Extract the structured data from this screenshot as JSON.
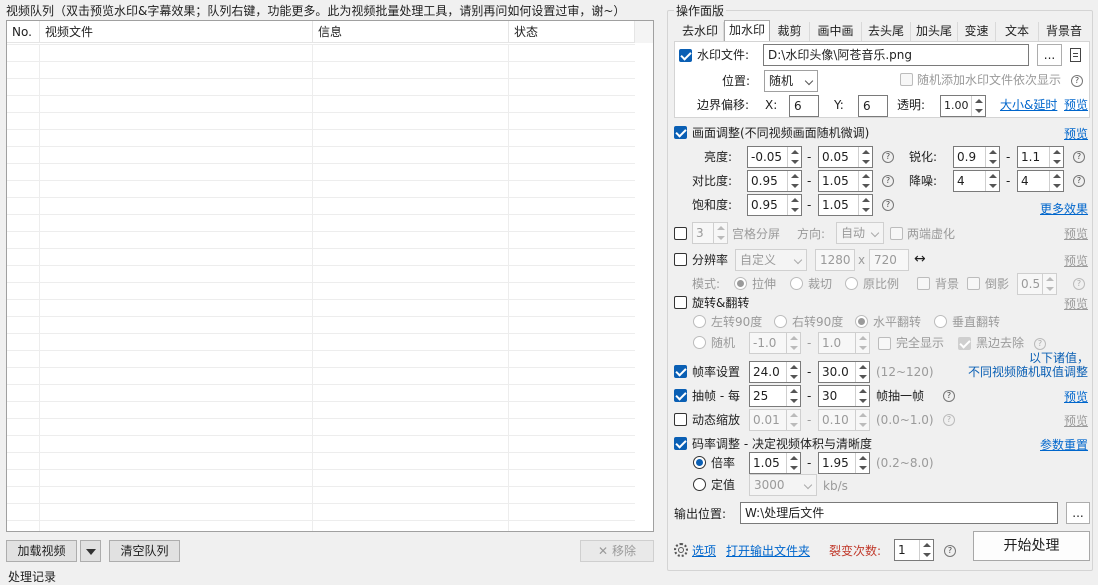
{
  "queue": {
    "title": "视频队列（双击预览水印&字幕效果；队列右键，功能更多。此为视频批量处理工具，请别再问如何设置过审，谢~）",
    "columns": [
      "No.",
      "视频文件",
      "信息",
      "状态"
    ],
    "load_video": "加载视频",
    "clear_queue": "清空队列",
    "remove": "移除",
    "log_title": "处理记录"
  },
  "panel": {
    "title": "操作面版",
    "tabs": [
      "去水印",
      "加水印",
      "裁剪",
      "画中画",
      "去头尾",
      "加头尾",
      "变速",
      "文本",
      "背景音"
    ],
    "active_tab": 1,
    "watermark": {
      "file_label": "水印文件:",
      "file_value": "D:\\水印头像\\阿苍音乐.png",
      "browse": "...",
      "position_label": "位置:",
      "position_value": "随机",
      "random_add_label": "随机添加水印文件依次显示",
      "margin_label": "边界偏移:",
      "x_label": "X:",
      "x_value": "6",
      "y_label": "Y:",
      "y_value": "6",
      "opacity_label": "透明:",
      "opacity_value": "1.00",
      "size_delay_link": "大小&延时",
      "preview": "预览"
    },
    "picture": {
      "label": "画面调整(不同视频画面随机微调)",
      "preview": "预览",
      "brightness_label": "亮度:",
      "brightness_min": "-0.05",
      "brightness_max": "0.05",
      "contrast_label": "对比度:",
      "contrast_min": "0.95",
      "contrast_max": "1.05",
      "saturation_label": "饱和度:",
      "saturation_min": "0.95",
      "saturation_max": "1.05",
      "sharpen_label": "锐化:",
      "sharpen_min": "0.9",
      "sharpen_max": "1.1",
      "denoise_label": "降噪:",
      "denoise_min": "4",
      "denoise_max": "4",
      "more_effects": "更多效果",
      "dash": "-",
      "q": "?"
    },
    "grid": {
      "value": "3",
      "label": "宫格分屏",
      "direction_label": "方向:",
      "direction_value": "自动",
      "blur_label": "两端虚化",
      "preview": "预览"
    },
    "resolution": {
      "label": "分辨率",
      "preset": "自定义",
      "width": "1280",
      "x": "x",
      "height": "720",
      "swap_icon": "↔",
      "preview": "预览",
      "mode_label": "模式:",
      "mode_stretch": "拉伸",
      "mode_crop": "裁切",
      "mode_ratio": "原比例",
      "bg_label": "背景",
      "reflect_label": "倒影",
      "reflect_value": "0.5"
    },
    "rotate": {
      "label": "旋转&翻转",
      "preview": "预览",
      "left90": "左转90度",
      "right90": "右转90度",
      "hflip": "水平翻转",
      "vflip": "垂直翻转",
      "random_label": "随机",
      "random_min": "-1.0",
      "random_max": "1.0",
      "full_show": "完全显示",
      "black_remove": "黑边去除"
    },
    "fps": {
      "label": "帧率设置",
      "min": "24.0",
      "max": "30.0",
      "range": "(12~120)",
      "note1": "以下诸值，",
      "note2": "不同视频随机取值调整"
    },
    "drop": {
      "label": "抽帧 - 每",
      "min": "25",
      "max": "30",
      "suffix": "帧抽一帧",
      "preview": "预览"
    },
    "zoom": {
      "label": "动态缩放",
      "min": "0.01",
      "max": "0.10",
      "range": "(0.0~1.0)",
      "preview": "预览"
    },
    "bitrate": {
      "label": "码率调整 - 决定视频体积与清晰度",
      "reset": "参数重置",
      "multiplier_label": "倍率",
      "multiplier_min": "1.05",
      "multiplier_max": "1.95",
      "multiplier_range": "(0.2~8.0)",
      "fixed_label": "定值",
      "fixed_value": "3000",
      "fixed_unit": "kb/s"
    },
    "output": {
      "label": "输出位置:",
      "path": "W:\\处理后文件",
      "browse": "..."
    },
    "footer": {
      "options": "选项",
      "open_folder": "打开输出文件夹",
      "fission_label": "裂变次数:",
      "fission_value": "1",
      "start": "开始处理"
    }
  },
  "colors": {
    "accent": "#0a5fb4",
    "link": "#0066cc",
    "fission": "#c0392b"
  }
}
